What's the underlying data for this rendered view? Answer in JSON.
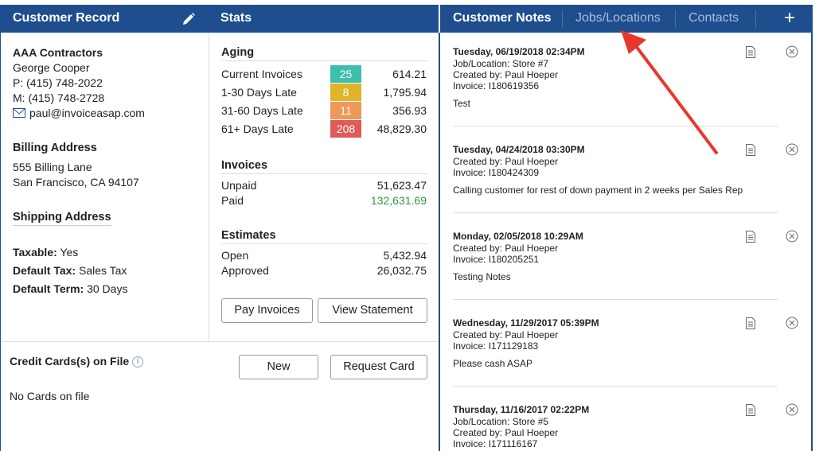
{
  "left_header": {
    "title": "Customer Record",
    "edit_icon": "pencil-icon"
  },
  "stats_header": {
    "title": "Stats"
  },
  "tabs": [
    {
      "label": "Customer Notes",
      "active": true
    },
    {
      "label": "Jobs/Locations",
      "active": false
    },
    {
      "label": "Contacts",
      "active": false
    }
  ],
  "add_icon": "+",
  "customer": {
    "company": "AAA Contractors",
    "contact": "George Cooper",
    "phone": "P: (415) 748-2022",
    "mobile": "M: (415) 748-2728",
    "email": "paul@invoiceasap.com"
  },
  "billing": {
    "heading": "Billing Address",
    "line1": "555 Billing Lane",
    "line2": "San Francisco, CA 94107"
  },
  "shipping": {
    "heading": "Shipping Address"
  },
  "terms": {
    "taxable_label": "Taxable:",
    "taxable_value": "Yes",
    "tax_label": "Default Tax:",
    "tax_value": "Sales Tax",
    "term_label": "Default Term:",
    "term_value": "30 Days"
  },
  "aging": {
    "heading": "Aging",
    "rows": [
      {
        "label": "Current Invoices",
        "count": "25",
        "amount": "614.21",
        "color": "#3dbfae"
      },
      {
        "label": "1-30 Days Late",
        "count": "8",
        "amount": "1,795.94",
        "color": "#e0b42a"
      },
      {
        "label": "31-60 Days Late",
        "count": "11",
        "amount": "356.93",
        "color": "#f0975a"
      },
      {
        "label": "61+ Days Late",
        "count": "208",
        "amount": "48,829.30",
        "color": "#e05a57"
      }
    ]
  },
  "invoices": {
    "heading": "Invoices",
    "unpaid_label": "Unpaid",
    "unpaid_value": "51,623.47",
    "paid_label": "Paid",
    "paid_value": "132,631.69",
    "paid_color": "#2e9b3a"
  },
  "estimates": {
    "heading": "Estimates",
    "open_label": "Open",
    "open_value": "5,432.94",
    "approved_label": "Approved",
    "approved_value": "26,032.75"
  },
  "buttons": {
    "pay_invoices": "Pay Invoices",
    "view_statement": "View Statement",
    "new": "New",
    "request_card": "Request Card"
  },
  "cards": {
    "heading": "Credit Cards(s) on File",
    "empty": "No Cards on file"
  },
  "notes": [
    {
      "date": "Tuesday, 06/19/2018 02:34PM",
      "lines": [
        "Job/Location: Store #7",
        "Created by: Paul Hoeper",
        "Invoice: I180619356"
      ],
      "text": "Test"
    },
    {
      "date": "Tuesday, 04/24/2018 03:30PM",
      "lines": [
        "Created by: Paul Hoeper",
        "Invoice: I180424309"
      ],
      "text": "Calling customer for rest of down payment in 2 weeks per Sales Rep"
    },
    {
      "date": "Monday, 02/05/2018 10:29AM",
      "lines": [
        "Created by: Paul Hoeper",
        "Invoice: I180205251"
      ],
      "text": "Testing Notes"
    },
    {
      "date": "Wednesday, 11/29/2017 05:39PM",
      "lines": [
        "Created by: Paul Hoeper",
        "Invoice: I171129183"
      ],
      "text": "Please cash ASAP"
    },
    {
      "date": "Thursday, 11/16/2017 02:22PM",
      "lines": [
        "Job/Location: Store #5",
        "Created by: Paul Hoeper",
        "Invoice: I171116167"
      ],
      "text": ""
    }
  ],
  "colors": {
    "header_bg": "#1f4e8f",
    "annotation_arrow": "#e8372b"
  }
}
